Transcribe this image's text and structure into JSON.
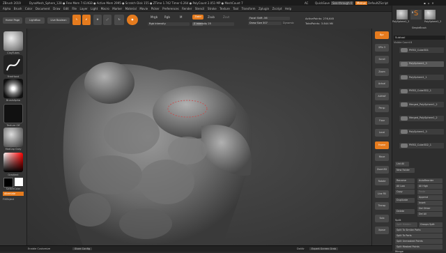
{
  "title_bar": {
    "app": "ZBrush 2019",
    "info": "DynaMesh_Sphere_128  ● Free Mem 7.614GB ● Active Mem 2995 ● Scratch Disk 155 ● ZTime 1.742 Timer 6.264 ● PolyCount 2.051 MP ● MeshCount 7",
    "ac": "AC",
    "quicksave": "QuickSave",
    "see_through": "See-through 0",
    "menus": "Menus",
    "script": "DefaultZScript"
  },
  "menu_bar": {
    "items": [
      "Alpha",
      "Brush",
      "Color",
      "Document",
      "Draw",
      "Edit",
      "File",
      "Layer",
      "Light",
      "Macro",
      "Marker",
      "Material",
      "Movie",
      "Picker",
      "Preferences",
      "Render",
      "Stencil",
      "Stroke",
      "Texture",
      "Tool",
      "Transform",
      "Zplugin",
      "Zscript",
      "Help"
    ],
    "switch_text": "Switching to Subtool 1: PolySphere1_3"
  },
  "toolbar": {
    "home": "Home Page",
    "lightbox": "LightBox",
    "live_boolean": "Live Boolean",
    "edit": "Edit",
    "draw": "Draw",
    "move": "Move",
    "scale": "Scale",
    "rotate": "Rotate",
    "mrgb": "Mrgb",
    "rgb": "Rgb",
    "m": "M",
    "zadd": "Zadd",
    "zsub": "Zsub",
    "zcut": "Zcut",
    "rgb_intensity": "Rgb Intensity",
    "z_intensity": "Z Intensity 25",
    "z_intensity_val": 0.25,
    "focal_shift": "Focal Shift -56",
    "draw_size": "Draw Size 307",
    "dynamic": "Dynamic",
    "active_points": "ActivePoints: 276,645",
    "total_points": "TotalPoints: 3.844 Mil"
  },
  "left_shelf": {
    "brush": "ClayTubes",
    "stroke": "FreeHand",
    "alpha": "BrushAlpha",
    "texture": "Texture Off",
    "material": "MatCap Gray",
    "gradient": "Gradient",
    "switch_color": "SwitchColor",
    "alternate": "Alternate",
    "fill_object": "FillObject"
  },
  "right_shelf": [
    "Bpr",
    "SPix 3",
    "Scroll",
    "Zoom",
    "Actual",
    "AAHalf",
    "Persp",
    "Floor",
    "Local",
    "Frame",
    "Move",
    "Zoom3D",
    "Rotate",
    "Line Fill",
    "Transp",
    "Solo",
    "Xpose"
  ],
  "tray": {
    "tool_thumbs": [
      "PolySphere1_3",
      "SimpleBrush",
      "PolySphere1_3"
    ],
    "count_a": "8",
    "count_b": "5",
    "subtool_header": "Subtool",
    "visible_count": "Visible Count 8",
    "subtools": [
      "PM3D_Cube3D1",
      "PolySphere1_3",
      "PolySphere1_1",
      "PM3D_Cube3D2_1",
      "Merged_PolySphere1_2",
      "Merged_PolySphere1_2",
      "PolySphere1_3",
      "PM3D_Cube3D2_1"
    ],
    "list_all": "List All",
    "new_folder": "New Folder",
    "rename": "Rename",
    "autoreorder": "AutoReorder",
    "all_low": "All Low",
    "all_high": "All High",
    "copy": "Copy",
    "paste": "Paste",
    "append": "Append",
    "duplicate": "Duplicate",
    "insert": "Insert",
    "delete": "Delete",
    "del_other": "Del Other",
    "del_all": "Del All",
    "split": "Split",
    "split_hidden": "Split Hidden",
    "groups_split": "Groups Split",
    "split_similar": "Split To Similar Parts",
    "split_parts": "Split To Parts",
    "split_unmasked": "Split Unmasked Points",
    "split_masked": "Split Masked Points",
    "merge": "Merge"
  },
  "status_bar": {
    "enable_customize": "Enable Customize",
    "store_config": "Store Config",
    "dollar": "DollAr",
    "expert_screen": "Expert Screen Grab"
  }
}
